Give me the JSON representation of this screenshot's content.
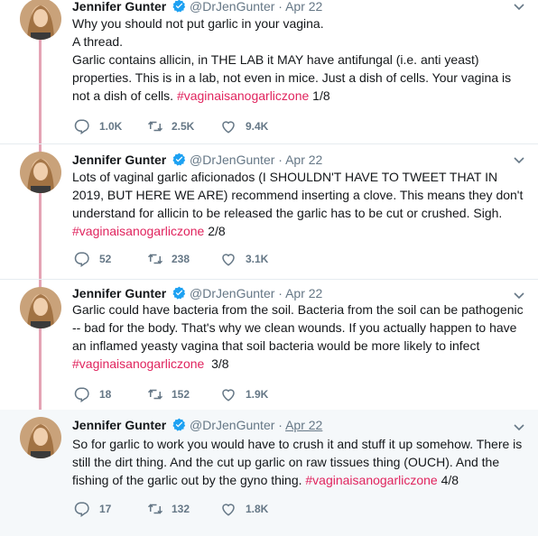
{
  "author": {
    "name": "Jennifer Gunter",
    "handle": "@DrJenGunter",
    "separator": "·"
  },
  "colors": {
    "hashtag": "#e0245e",
    "thread_line": "#e4a4b5",
    "verified": "#1da1f2",
    "muted": "#657786"
  },
  "tweets": [
    {
      "date": "Apr 22",
      "lines": [
        "Why you should not put garlic in your vagina.",
        "A thread."
      ],
      "text": "Garlic contains allicin, in THE LAB it MAY have antifungal (i.e. anti yeast) properties. This is in a lab, not even in mice. Just a dish of cells. Your vagina is not a dish of cells. ",
      "hashtag": "#vaginaisanogarliczone",
      "counter": " 1/8",
      "replies": "1.0K",
      "retweets": "2.5K",
      "likes": "9.4K"
    },
    {
      "date": "Apr 22",
      "text": "Lots of vaginal garlic aficionados (I SHOULDN'T HAVE TO TWEET THAT IN 2019, BUT HERE WE ARE) recommend inserting a clove. This means they don't understand for allicin to be released the garlic has to be cut or crushed. Sigh. ",
      "hashtag": "#vaginaisanogarliczone",
      "counter": " 2/8",
      "replies": "52",
      "retweets": "238",
      "likes": "3.1K"
    },
    {
      "date": "Apr 22",
      "text": "Garlic could have bacteria from the soil. Bacteria from the soil can be pathogenic -- bad for the body. That's why we clean wounds. If you actually happen to have an inflamed yeasty vagina that soil bacteria would be more likely to infect ",
      "hashtag": "#vaginaisanogarliczone",
      "counter": "  3/8",
      "replies": "18",
      "retweets": "152",
      "likes": "1.9K"
    },
    {
      "date": "Apr 22",
      "text": "So for garlic to work you would have to crush it and stuff it up somehow. There is still the dirt thing. And the cut up garlic on raw tissues thing (OUCH). And the fishing of the garlic out by the gyno thing. ",
      "hashtag": "#vaginaisanogarliczone",
      "counter": " 4/8",
      "replies": "17",
      "retweets": "132",
      "likes": "1.8K"
    }
  ]
}
